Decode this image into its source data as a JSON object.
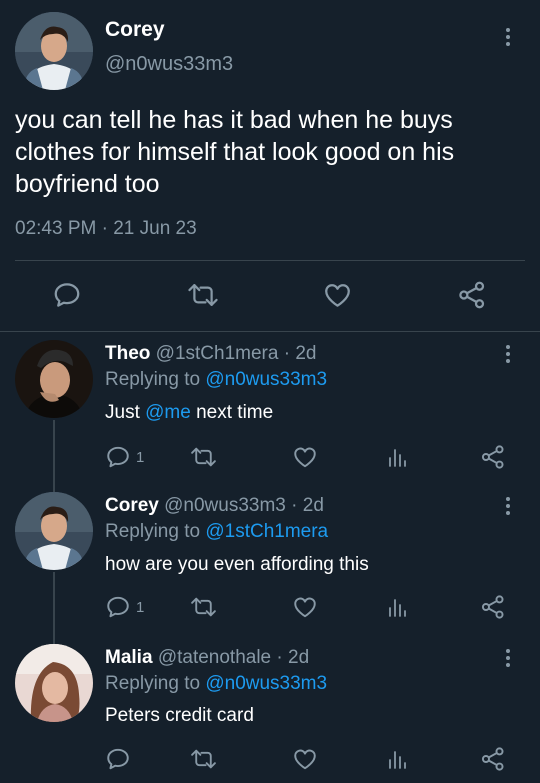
{
  "main_tweet": {
    "name": "Corey",
    "handle": "@n0wus33m3",
    "text": "you can tell he has it bad when he buys clothes for himself that look good on his boyfriend too",
    "time": "02:43 PM",
    "separator": "·",
    "date": "21 Jun 23"
  },
  "replies": [
    {
      "name": "Theo",
      "handle": "@1stCh1mera",
      "age": "· 2d",
      "replying_prefix": "Replying to",
      "replying_to": "@n0wus33m3",
      "text_before": "Just",
      "mention": "@me",
      "text_after": "next time",
      "reply_count": "1"
    },
    {
      "name": "Corey",
      "handle": "@n0wus33m3",
      "age": "· 2d",
      "replying_prefix": "Replying to",
      "replying_to": "@1stCh1mera",
      "text": "how are you even affording this",
      "reply_count": "1"
    },
    {
      "name": "Malia",
      "handle": "@tatenothale",
      "age": "· 2d",
      "replying_prefix": "Replying to",
      "replying_to": "@n0wus33m3",
      "text": "Peters credit card",
      "reply_count": ""
    }
  ],
  "colors": {
    "background": "#15202b",
    "muted": "#8899a6",
    "link": "#1d9bf0",
    "divider": "#38444d"
  },
  "icons": [
    "reply-icon",
    "retweet-icon",
    "like-icon",
    "share-icon",
    "views-icon",
    "more-icon"
  ]
}
